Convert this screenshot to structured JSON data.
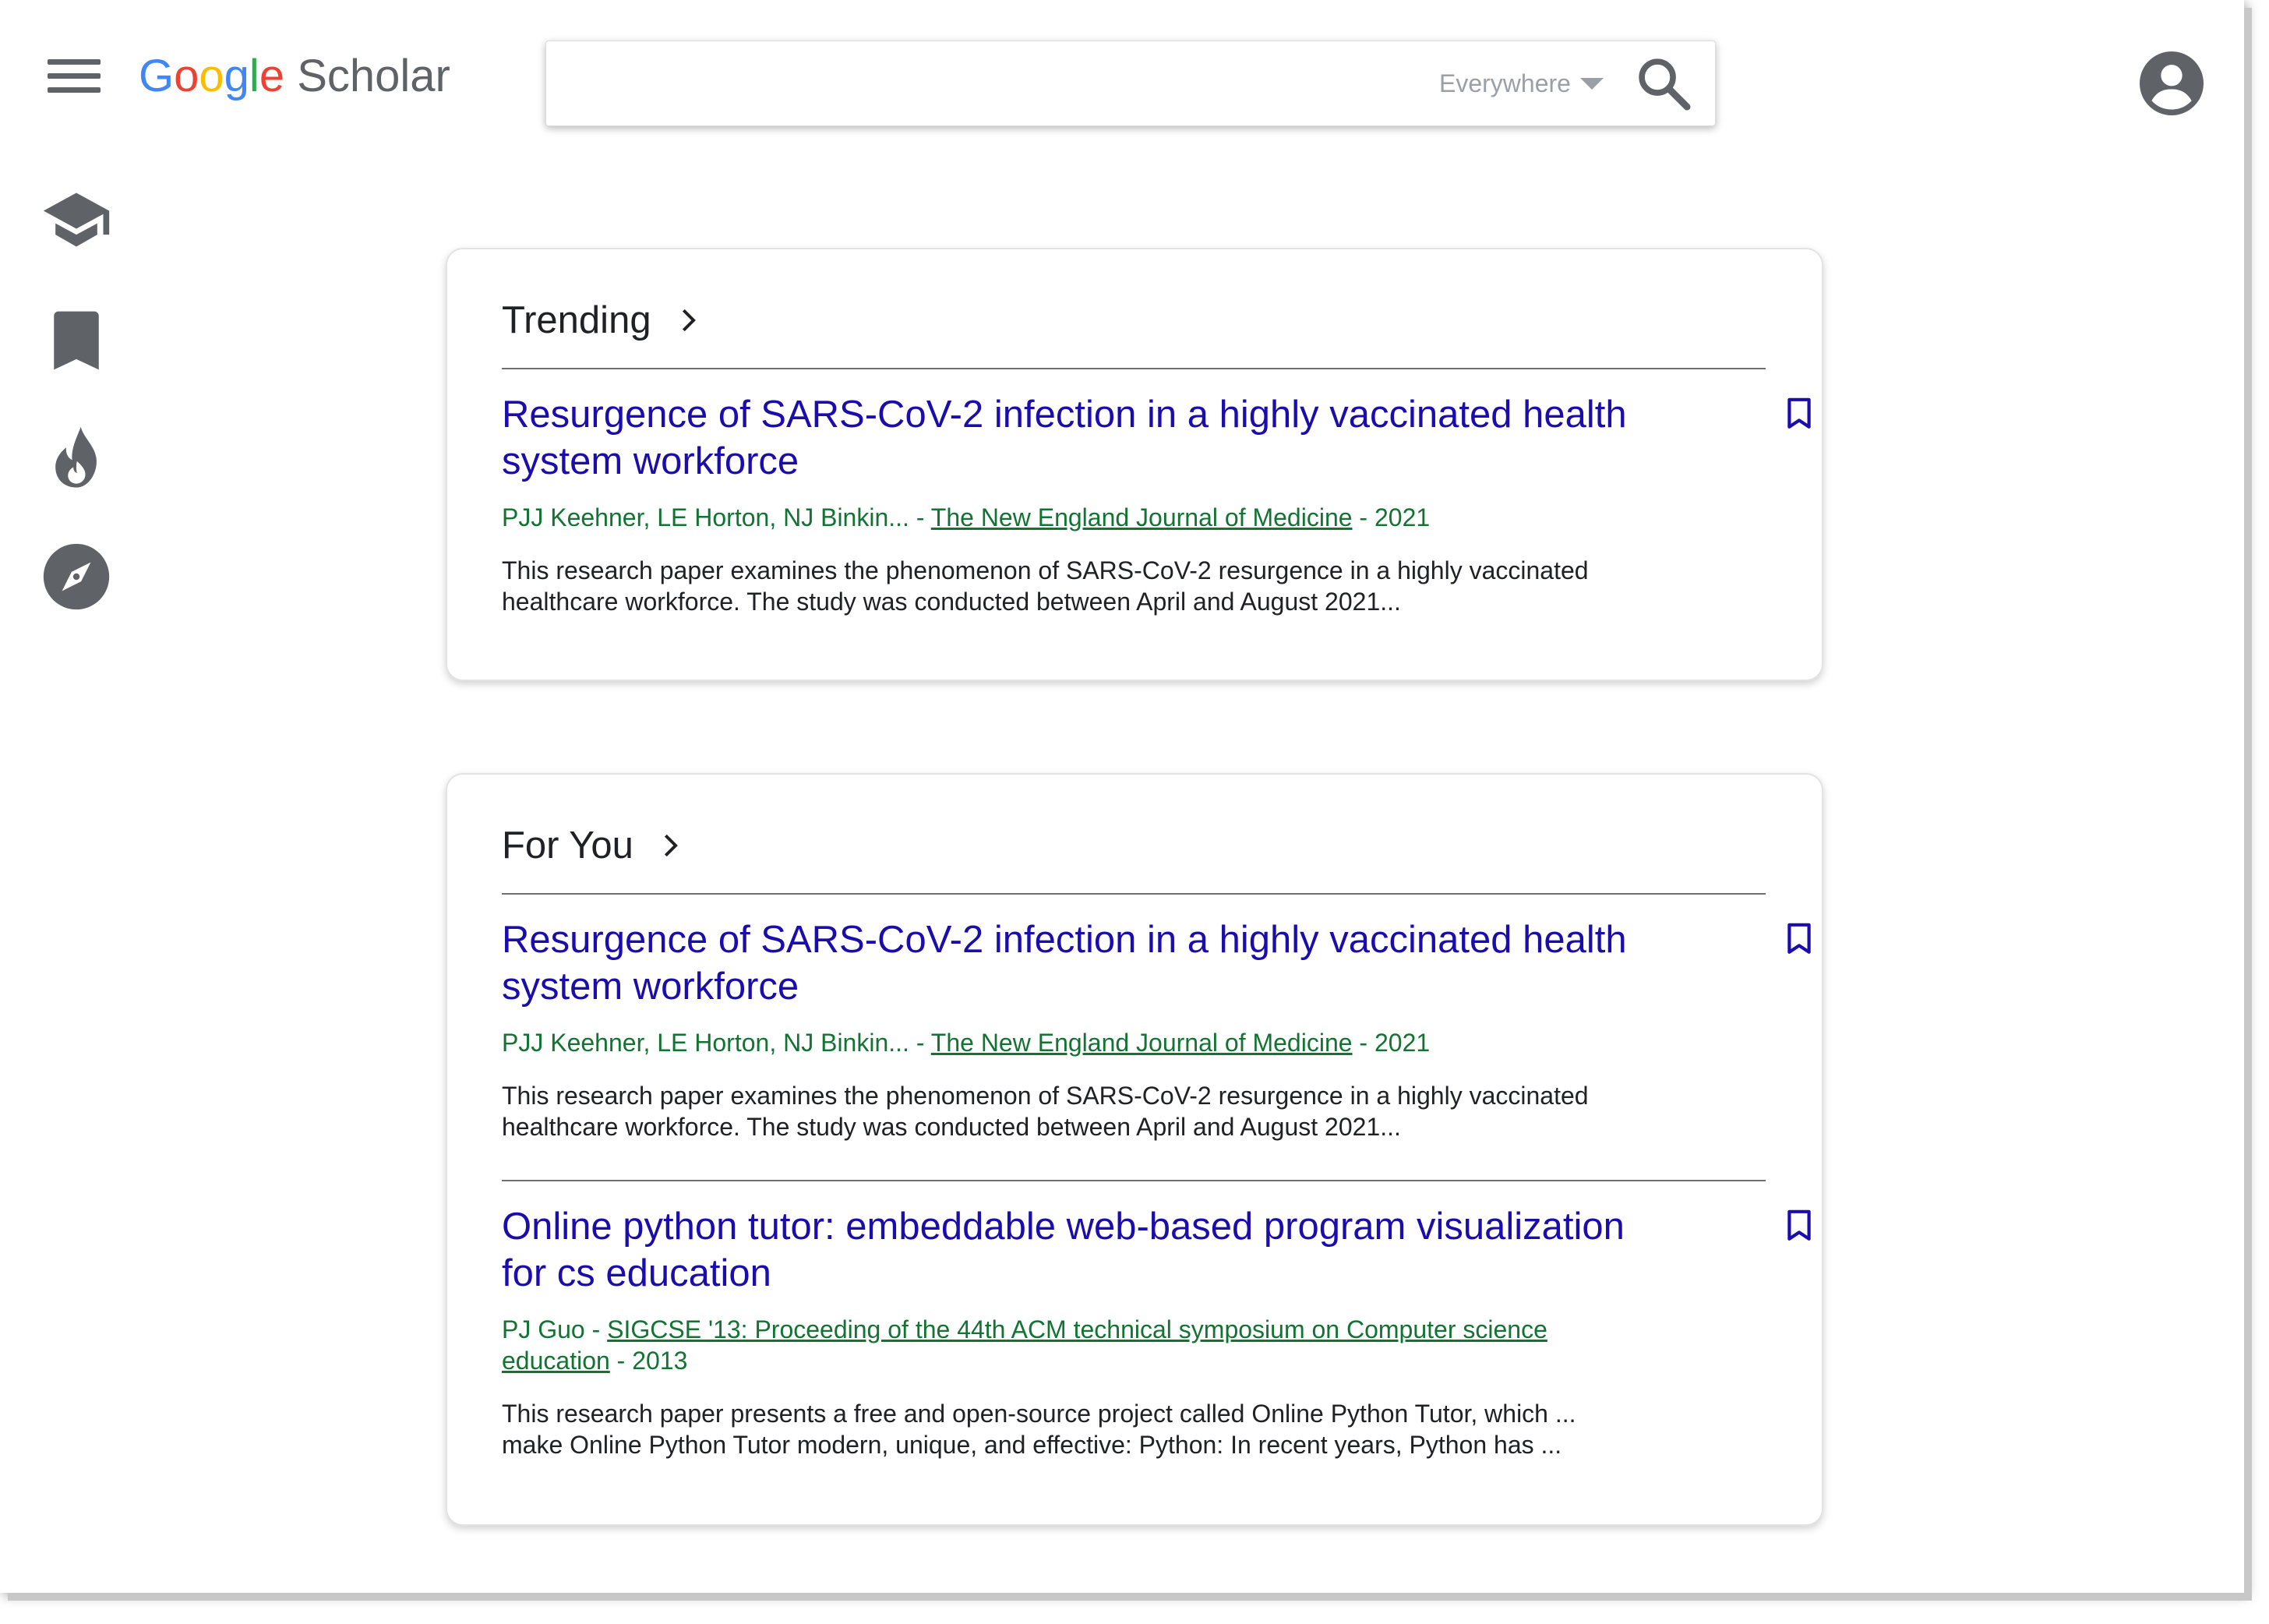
{
  "header": {
    "logo": {
      "google": "Google",
      "scholar": "Scholar"
    },
    "search": {
      "value": "",
      "placeholder": "",
      "scope_label": "Everywhere"
    },
    "icons": {
      "menu": "hamburger-menu-icon",
      "search": "search-icon",
      "account": "account-circle-icon"
    }
  },
  "sidebar": {
    "items": [
      {
        "icon": "graduation-cap-icon",
        "name": "library"
      },
      {
        "icon": "bookmark-icon",
        "name": "saved"
      },
      {
        "icon": "flame-icon",
        "name": "trending"
      },
      {
        "icon": "compass-icon",
        "name": "explore"
      }
    ]
  },
  "sections": [
    {
      "title": "Trending",
      "results": [
        {
          "title": "Resurgence of SARS-CoV-2 infection in a highly vaccinated health system workforce",
          "authors": "PJJ Keehner, LE Horton, NJ Binkin...",
          "venue": "The New England Journal of Medicine",
          "year": "2021",
          "snippet": "This research paper examines the phenomenon of SARS-CoV-2 resurgence in a highly vaccinated healthcare workforce. The study was conducted between April and August 2021..."
        }
      ]
    },
    {
      "title": "For You",
      "results": [
        {
          "title": "Resurgence of SARS-CoV-2 infection in a highly vaccinated health system workforce",
          "authors": "PJJ Keehner, LE Horton, NJ Binkin...",
          "venue": "The New England Journal of Medicine",
          "year": "2021",
          "snippet": "This research paper examines the phenomenon of SARS-CoV-2 resurgence in a highly vaccinated healthcare workforce. The study was conducted between April and August 2021..."
        },
        {
          "title": "Online python tutor: embeddable web-based program visualization for cs education",
          "authors": "PJ Guo",
          "venue": "SIGCSE '13: Proceeding of the 44th ACM technical symposium on Computer science education",
          "year": "2013",
          "snippet": "This research paper presents a free and open-source project called Online Python Tutor, which ... make Online Python Tutor modern, unique, and effective: Python: In recent years, Python has ..."
        }
      ]
    }
  ],
  "separators": {
    "meta": " - "
  },
  "colors": {
    "title_link": "#1a0dab",
    "meta_green": "#137333",
    "icon_gray": "#5f6368",
    "bookmark_blue": "#1a0dab"
  }
}
